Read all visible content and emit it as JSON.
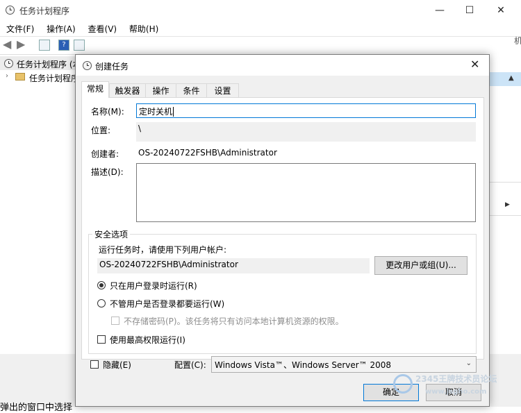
{
  "main_window": {
    "title": "任务计划程序",
    "menu": [
      "文件(F)",
      "操作(A)",
      "查看(V)",
      "帮助(H)"
    ],
    "tree": {
      "root": "任务计划程序 (本",
      "library": "任务计划程序库"
    },
    "right_edge_char": "机",
    "bottom_partial": "弹出的窗口中选择"
  },
  "dialog": {
    "title": "创建任务",
    "tabs": [
      "常规",
      "触发器",
      "操作",
      "条件",
      "设置"
    ],
    "name_label": "名称(M):",
    "name_value": "定时关机",
    "location_label": "位置:",
    "location_value": "\\",
    "author_label": "创建者:",
    "author_value": "OS-20240722FSHB\\Administrator",
    "description_label": "描述(D):",
    "description_value": "",
    "security": {
      "title": "安全选项",
      "prompt": "运行任务时，请使用下列用户帐户:",
      "account": "OS-20240722FSHB\\Administrator",
      "change_user_button": "更改用户或组(U)...",
      "radio_logged_on": "只在用户登录时运行(R)",
      "radio_whether": "不管用户是否登录都要运行(W)",
      "no_store_password": "不存储密码(P)。该任务将只有访问本地计算机资源的权限。",
      "highest_privileges": "使用最高权限运行(I)"
    },
    "hidden_label": "隐藏(E)",
    "config_label": "配置(C):",
    "config_value": "Windows Vista™、Windows Server™ 2008",
    "ok_button": "确定",
    "cancel_button": "取消"
  },
  "watermark": {
    "line1": "2345王牌技术员论坛",
    "line2": "www.jsgho.com"
  }
}
